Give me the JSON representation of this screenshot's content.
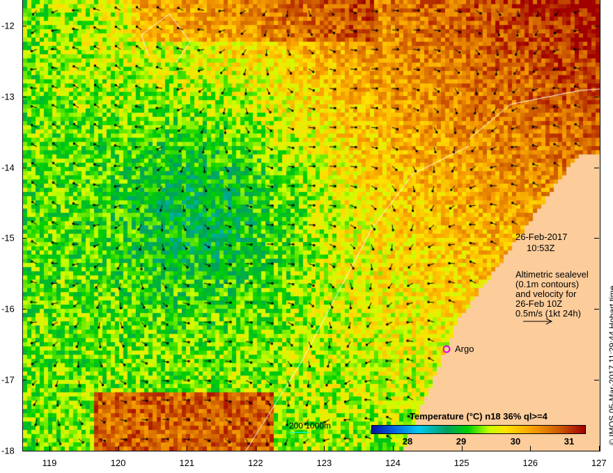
{
  "map": {
    "lon_ticks": [
      "119",
      "120",
      "121",
      "122",
      "123",
      "124",
      "125",
      "126",
      "127"
    ],
    "lat_ticks": [
      "-12",
      "-13",
      "-14",
      "-15",
      "-16",
      "-17",
      "-18"
    ],
    "land_color": "#fccc9a"
  },
  "annotation": {
    "date": "26-Feb-2017",
    "time": "10:53Z",
    "desc": [
      "Altimetric sealevel",
      "(0.1m contours)",
      "and velocity for",
      "26-Feb 10Z",
      "0.5m/s (1kt 24h)"
    ]
  },
  "argo": {
    "label": "Argo",
    "color": "#e000e0"
  },
  "scale": {
    "label": "200  1000m"
  },
  "colorbar": {
    "title": "Temperature (°C) n18 36% ql>=4",
    "ticks": [
      "28",
      "29",
      "30",
      "31"
    ],
    "range": [
      27.7,
      31.3
    ]
  },
  "credit": "© IMOS 05-Mar-2017 11:29:44 Hobart time"
}
